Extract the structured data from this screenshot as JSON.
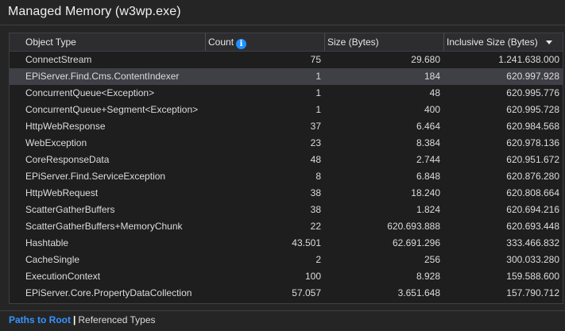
{
  "window": {
    "title": "Managed Memory (w3wp.exe)"
  },
  "table": {
    "columns": {
      "object_type": "Object Type",
      "count": "Count",
      "size": "Size (Bytes)",
      "inclusive_size": "Inclusive Size (Bytes)"
    },
    "count_info_icon": "i",
    "sorted_column": "inclusive_size",
    "sort_direction": "descending",
    "selected_row": 1,
    "rows": [
      {
        "type": "ConnectStream",
        "count": "75",
        "size": "29.680",
        "inclusive": "1.241.638.000"
      },
      {
        "type": "EPiServer.Find.Cms.ContentIndexer",
        "count": "1",
        "size": "184",
        "inclusive": "620.997.928"
      },
      {
        "type": "ConcurrentQueue<Exception>",
        "count": "1",
        "size": "48",
        "inclusive": "620.995.776"
      },
      {
        "type": "ConcurrentQueue+Segment<Exception>",
        "count": "1",
        "size": "400",
        "inclusive": "620.995.728"
      },
      {
        "type": "HttpWebResponse",
        "count": "37",
        "size": "6.464",
        "inclusive": "620.984.568"
      },
      {
        "type": "WebException",
        "count": "23",
        "size": "8.384",
        "inclusive": "620.978.136"
      },
      {
        "type": "CoreResponseData",
        "count": "48",
        "size": "2.744",
        "inclusive": "620.951.672"
      },
      {
        "type": "EPiServer.Find.ServiceException",
        "count": "8",
        "size": "6.848",
        "inclusive": "620.876.280"
      },
      {
        "type": "HttpWebRequest",
        "count": "38",
        "size": "18.240",
        "inclusive": "620.808.664"
      },
      {
        "type": "ScatterGatherBuffers",
        "count": "38",
        "size": "1.824",
        "inclusive": "620.694.216"
      },
      {
        "type": "ScatterGatherBuffers+MemoryChunk",
        "count": "22",
        "size": "620.693.888",
        "inclusive": "620.693.448"
      },
      {
        "type": "Hashtable",
        "count": "43.501",
        "size": "62.691.296",
        "inclusive": "333.466.832"
      },
      {
        "type": "CacheSingle",
        "count": "2",
        "size": "256",
        "inclusive": "300.033.280"
      },
      {
        "type": "ExecutionContext",
        "count": "100",
        "size": "8.928",
        "inclusive": "159.588.600"
      },
      {
        "type": "EPiServer.Core.PropertyDataCollection",
        "count": "57.057",
        "size": "3.651.648",
        "inclusive": "157.790.712"
      }
    ]
  },
  "footer": {
    "paths_to_root": "Paths to Root",
    "separator": "|",
    "referenced_types": "Referenced Types"
  },
  "colors": {
    "background": "#252526",
    "grid_background": "#1e1e1e",
    "selected_row": "#3f3f46",
    "link": "#3794ff",
    "info_icon": "#1e90ff"
  }
}
